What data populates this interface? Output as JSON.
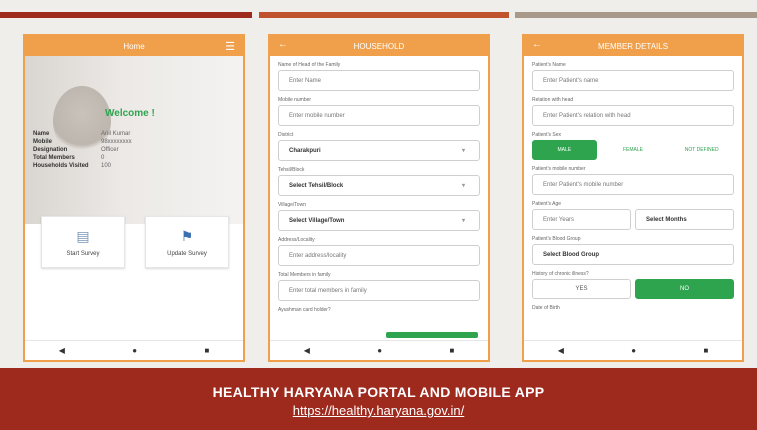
{
  "colors": {
    "accent": "#f0a04b",
    "green": "#2ea44f",
    "footer": "#9e2a1e"
  },
  "phone1": {
    "appbar_title": "Home",
    "menu_icon": "menu-icon",
    "welcome": "Welcome !",
    "info": [
      {
        "k": "Name",
        "v": "Anil Kumar"
      },
      {
        "k": "Mobile",
        "v": "98xxxxxxxx"
      },
      {
        "k": "Designation",
        "v": "Officer"
      },
      {
        "k": "Total Members",
        "v": "0"
      },
      {
        "k": "Households Visited",
        "v": "100"
      }
    ],
    "tiles": [
      {
        "label": "Start Survey",
        "icon": "document-icon"
      },
      {
        "label": "Update Survey",
        "icon": "flag-icon"
      }
    ],
    "nav": [
      "◀",
      "●",
      "■"
    ]
  },
  "phone2": {
    "appbar_title": "HOUSEHOLD",
    "fields": [
      {
        "label": "Name of Head of the Family",
        "value": "Enter Name",
        "bold": false,
        "select": false
      },
      {
        "label": "Mobile number",
        "value": "Enter mobile number",
        "bold": false,
        "select": false
      },
      {
        "label": "District",
        "value": "Charakpuri",
        "bold": true,
        "select": true
      },
      {
        "label": "Tehsil/Block",
        "value": "Select Tehsil/Block",
        "bold": true,
        "select": true
      },
      {
        "label": "Village/Town",
        "value": "Select Village/Town",
        "bold": true,
        "select": true
      },
      {
        "label": "Address/Locality",
        "value": "Enter address/locality",
        "bold": false,
        "select": false
      },
      {
        "label": "Total Members in family",
        "value": "Enter total members in family",
        "bold": false,
        "select": false
      }
    ],
    "last_label": "Ayushman card holder?",
    "nav": [
      "◀",
      "●",
      "■"
    ]
  },
  "phone3": {
    "appbar_title": "MEMBER DETAILS",
    "name": {
      "label": "Patient's Name",
      "value": "Enter Patient's name"
    },
    "relation": {
      "label": "Relation with head",
      "value": "Enter Patient's relation with head"
    },
    "gender_label": "Patient's Sex",
    "gender": [
      "MALE",
      "FEMALE",
      "NOT DEFINED"
    ],
    "mobile": {
      "label": "Patient's mobile number",
      "value": "Enter Patient's mobile number"
    },
    "age_label": "Patient's Age",
    "age": [
      "Enter Years",
      "Select Months"
    ],
    "blood": {
      "label": "Patient's Blood Group",
      "value": "Select Blood Group"
    },
    "checked_label": "History of chronic illness?",
    "yesno": [
      "YES",
      "NO"
    ],
    "last_label": "Date of Birth",
    "nav": [
      "◀",
      "●",
      "■"
    ]
  },
  "footer": {
    "title": "HEALTHY HARYANA PORTAL AND MOBILE APP",
    "link": "https://healthy.haryana.gov.in/"
  }
}
